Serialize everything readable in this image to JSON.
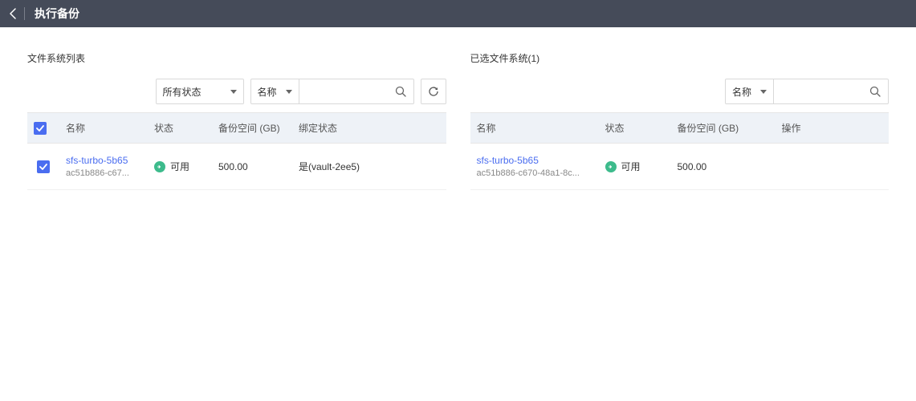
{
  "header": {
    "title": "执行备份"
  },
  "left_panel": {
    "title": "文件系统列表",
    "filter_status": "所有状态",
    "search_type": "名称",
    "search_placeholder": "",
    "columns": {
      "name": "名称",
      "status": "状态",
      "space": "备份空间 (GB)",
      "bind": "绑定状态"
    },
    "rows": [
      {
        "name_link": "sfs-turbo-5b65",
        "name_sub": "ac51b886-c67...",
        "status_text": "可用",
        "space": "500.00",
        "bind": "是(vault-2ee5)",
        "checked": true
      }
    ]
  },
  "right_panel": {
    "title": "已选文件系统(1)",
    "search_type": "名称",
    "search_placeholder": "",
    "columns": {
      "name": "名称",
      "status": "状态",
      "space": "备份空间 (GB)",
      "op": "操作"
    },
    "rows": [
      {
        "name_link": "sfs-turbo-5b65",
        "name_sub": "ac51b886-c670-48a1-8c...",
        "status_text": "可用",
        "space": "500.00"
      }
    ]
  }
}
